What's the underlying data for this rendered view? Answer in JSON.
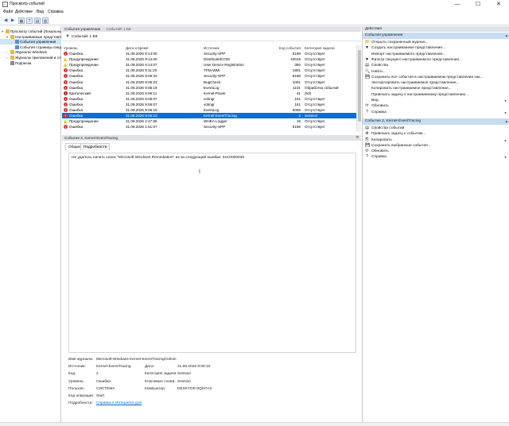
{
  "window": {
    "title": "Просмотр событий",
    "controls": [
      "—",
      "☐",
      "✕"
    ]
  },
  "menu": [
    "Файл",
    "Действие",
    "Вид",
    "Справка"
  ],
  "tree": [
    {
      "label": "Просмотр событий (Локальный)",
      "level": 0,
      "twist": "▾",
      "icon": "folder"
    },
    {
      "label": "Настраиваемые представления",
      "level": 1,
      "twist": "▾",
      "icon": "folder"
    },
    {
      "label": "События управления",
      "level": 2,
      "twist": "",
      "icon": "filter",
      "selected": true
    },
    {
      "label": "События страницы сведений",
      "level": 2,
      "twist": "",
      "icon": "filter"
    },
    {
      "label": "Журналы Windows",
      "level": 1,
      "twist": "›",
      "icon": "folder"
    },
    {
      "label": "Журналы приложений и служб",
      "level": 1,
      "twist": "›",
      "icon": "folder"
    },
    {
      "label": "Подписки",
      "level": 1,
      "twist": "",
      "icon": "doc"
    }
  ],
  "center": {
    "header_title": "События управления",
    "header_count": "Событий: 1 Б8",
    "filter_text": "Событий: 1 Б8",
    "columns": [
      "Уровень",
      "Дата и время",
      "Источник",
      "Код события",
      "Категория задачи"
    ],
    "rows": [
      {
        "level": "Ошибка",
        "kind": "err",
        "date": "31.08.2026 9:14:00",
        "source": "Security-SPP",
        "code": "8198",
        "task": "Отсутствует"
      },
      {
        "level": "Предупреждение",
        "kind": "warn",
        "date": "31.08.2026 9:14:00",
        "source": "DistributedCOM",
        "code": "10016",
        "task": "Отсутствует"
      },
      {
        "level": "Предупреждение",
        "kind": "warn",
        "date": "31.08.2026 9:14:07",
        "source": "User Device Registration",
        "code": "360",
        "task": "Отсутствует"
      },
      {
        "level": "Ошибка",
        "kind": "err",
        "date": "31.08.2026 9:11:20",
        "source": "TPM-WMI",
        "code": "1801",
        "task": "Отсутствует"
      },
      {
        "level": "Ошибка",
        "kind": "err",
        "date": "31.08.2026 9:06:33",
        "source": "Security-SPP",
        "code": "8198",
        "task": "Отсутствует"
      },
      {
        "level": "Ошибка",
        "kind": "err",
        "date": "31.08.2026 9:06:23",
        "source": "BugCheck",
        "code": "1001",
        "task": "Отсутствует"
      },
      {
        "level": "Ошибка",
        "kind": "err",
        "date": "31.08.2026 9:06:19",
        "source": "EventLog",
        "code": "1101",
        "task": "Обработка событий"
      },
      {
        "level": "Критический",
        "kind": "crit",
        "date": "31.08.2026 9:06:11",
        "source": "Kernel-Power",
        "code": "41",
        "task": "(63)"
      },
      {
        "level": "Ошибка",
        "kind": "err",
        "date": "31.08.2026 9:06:07",
        "source": "volmgr",
        "code": "161",
        "task": "Отсутствует"
      },
      {
        "level": "Ошибка",
        "kind": "err",
        "date": "31.08.2026 9:06:07",
        "source": "volmgr",
        "code": "161",
        "task": "Отсутствует"
      },
      {
        "level": "Ошибка",
        "kind": "err",
        "date": "31.08.2026 9:06:19",
        "source": "EventLog",
        "code": "6008",
        "task": "Отсутствует"
      },
      {
        "level": "Ошибка",
        "kind": "err",
        "date": "31.08.2026 9:06:10",
        "source": "Kernel-EventTracing",
        "code": "2",
        "task": "Session",
        "selected": true
      },
      {
        "level": "Предупреждение",
        "kind": "warn",
        "date": "31.08.2026 2:47:58",
        "source": "WHEA-Logger",
        "code": "19",
        "task": "Отсутствует"
      },
      {
        "level": "Ошибка",
        "kind": "err",
        "date": "31.08.2026 1:51:07",
        "source": "Security-SPP",
        "code": "8198",
        "task": "Отсутствует"
      }
    ]
  },
  "detail": {
    "header_title": "Событие 2, Kernel-EventTracing",
    "tabs": [
      "Общие",
      "Подробности"
    ],
    "message": "Не удалось начать сеанс \"Microsoft.Windows.Remediation\" из-за следующей ошибки: 0xC0000035",
    "props": {
      "log_name_label": "Имя журнала:",
      "log_name": "Microsoft-Windows-Kernel-EventTracing/Admin",
      "source_label": "Источник:",
      "source": "Kernel-EventTracing",
      "date_label": "Дата:",
      "date": "31.08.2026 9:06:10",
      "code_label": "Код:",
      "code": "2",
      "task_label": "Категория задачи:",
      "task": "Session",
      "level_label": "Уровень:",
      "level": "Ошибка",
      "keywords_label": "Ключевые слова:",
      "keywords": "Session",
      "user_label": "Пользов.:",
      "user": "СИСТЕМА",
      "computer_label": "Компьютер:",
      "computer": "DESKTOP-0Q0I7A2",
      "opcode_label": "Код операции:",
      "opcode": "Start",
      "more_label": "Подробности:",
      "more_link": "Справка в Интернете для"
    }
  },
  "actions": {
    "header": "Действия",
    "section1": "События управления",
    "items1": [
      {
        "label": "Открыть сохраненный журнал...",
        "icon": "📂",
        "sub": ""
      },
      {
        "label": "Создать настраиваемое представление...",
        "icon": "▼",
        "sub": ""
      },
      {
        "label": "Импорт настраиваемого представления...",
        "icon": "",
        "sub": ""
      },
      {
        "label": "Фильтр текущего настраиваемого представления...",
        "icon": "▼",
        "sub": ""
      },
      {
        "label": "Свойства",
        "icon": "▤",
        "sub": ""
      },
      {
        "label": "Найти...",
        "icon": "🔍",
        "sub": ""
      },
      {
        "label": "Сохранить все события в настраиваемом представлении как...",
        "icon": "💾",
        "sub": ""
      },
      {
        "label": "Экспортировать настраиваемое представление...",
        "icon": "",
        "sub": ""
      },
      {
        "label": "Копировать настраиваемое представление...",
        "icon": "",
        "sub": ""
      },
      {
        "label": "Привязать задачу к настраиваемому представлению...",
        "icon": "",
        "sub": ""
      },
      {
        "label": "Вид",
        "icon": "",
        "sub": "▸"
      },
      {
        "label": "Обновить",
        "icon": "⟳",
        "sub": ""
      },
      {
        "label": "Справка",
        "icon": "?",
        "sub": "▸"
      }
    ],
    "section2": "Событие 2, Kernel-EventTracing",
    "items2": [
      {
        "label": "Свойства событий",
        "icon": "▤",
        "sub": ""
      },
      {
        "label": "Привязать задачу к событию...",
        "icon": "⚙",
        "sub": ""
      },
      {
        "label": "Копировать",
        "icon": "⎘",
        "sub": "▸"
      },
      {
        "label": "Сохранить выбранные события...",
        "icon": "💾",
        "sub": ""
      },
      {
        "label": "Обновить",
        "icon": "⟳",
        "sub": ""
      },
      {
        "label": "Справка",
        "icon": "?",
        "sub": "▸"
      }
    ]
  },
  "colors": {
    "selection": "#0a6fd3",
    "section": "#c7dcf2",
    "error": "#d13438",
    "warning": "#f5c400"
  }
}
